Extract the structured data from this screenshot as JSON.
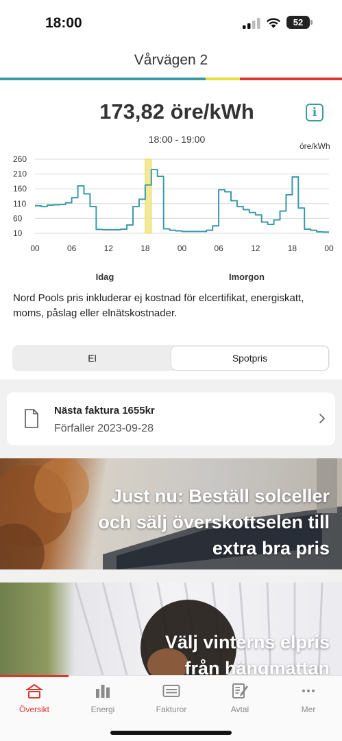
{
  "status_bar": {
    "time": "18:00",
    "battery": "52",
    "icons": [
      "cellular-signal-icon",
      "wifi-icon",
      "battery-icon"
    ]
  },
  "header": {
    "title": "Vårvägen 2"
  },
  "colors": {
    "teal": "#3a9aa6",
    "yellow": "#e7dc3c",
    "red": "#d9382e",
    "highlight": "#f2e89a"
  },
  "price": {
    "value": "173,82 öre/kWh",
    "time_range": "18:00 - 19:00",
    "info_icon": "info-icon"
  },
  "chart_data": {
    "type": "line",
    "step": true,
    "unit_label": "öre/kWh",
    "y_ticks": [
      "260",
      "210",
      "160",
      "110",
      "60",
      "10"
    ],
    "ylim": [
      10,
      260
    ],
    "x_ticks": [
      "00",
      "06",
      "12",
      "18",
      "00",
      "06",
      "12",
      "18",
      "00"
    ],
    "day_labels": [
      "Idag",
      "Imorgon"
    ],
    "highlight_hour": 18,
    "x": [
      0,
      1,
      2,
      3,
      4,
      5,
      6,
      7,
      8,
      9,
      10,
      11,
      12,
      13,
      14,
      15,
      16,
      17,
      18,
      19,
      20,
      21,
      22,
      23,
      24,
      25,
      26,
      27,
      28,
      29,
      30,
      31,
      32,
      33,
      34,
      35,
      36,
      37,
      38,
      39,
      40,
      41,
      42,
      43,
      44,
      45,
      46,
      47
    ],
    "values": [
      103,
      100,
      105,
      106,
      107,
      113,
      130,
      170,
      143,
      100,
      23,
      22,
      22,
      22,
      24,
      38,
      100,
      125,
      173,
      225,
      202,
      25,
      20,
      18,
      16,
      16,
      16,
      16,
      20,
      35,
      157,
      150,
      120,
      100,
      90,
      80,
      72,
      48,
      40,
      55,
      85,
      140,
      200,
      95,
      24,
      20,
      15,
      14
    ]
  },
  "footnote": "Nord Pools pris inkluderar ej kostnad för elcertifikat, energiskatt, moms, påslag eller elnätskostnader.",
  "segments": {
    "left": "El",
    "right": "Spotpris",
    "selected": "Spotpris"
  },
  "invoice": {
    "title": "Nästa faktura 1655kr",
    "due": "Förfaller 2023-09-28",
    "icon": "document-icon"
  },
  "promos": [
    {
      "lines": [
        "Just nu: Beställ solceller",
        "och sälj överskottselen till",
        "extra bra pris"
      ]
    },
    {
      "lines": [
        "Välj vinterns elpris",
        "från hängmattan"
      ]
    }
  ],
  "tabs": [
    {
      "label": "Översikt",
      "icon": "home-icon",
      "active": true
    },
    {
      "label": "Energi",
      "icon": "bar-chart-icon",
      "active": false
    },
    {
      "label": "Fakturor",
      "icon": "invoice-icon",
      "active": false
    },
    {
      "label": "Avtal",
      "icon": "contract-icon",
      "active": false
    },
    {
      "label": "Mer",
      "icon": "more-icon",
      "active": false
    }
  ]
}
